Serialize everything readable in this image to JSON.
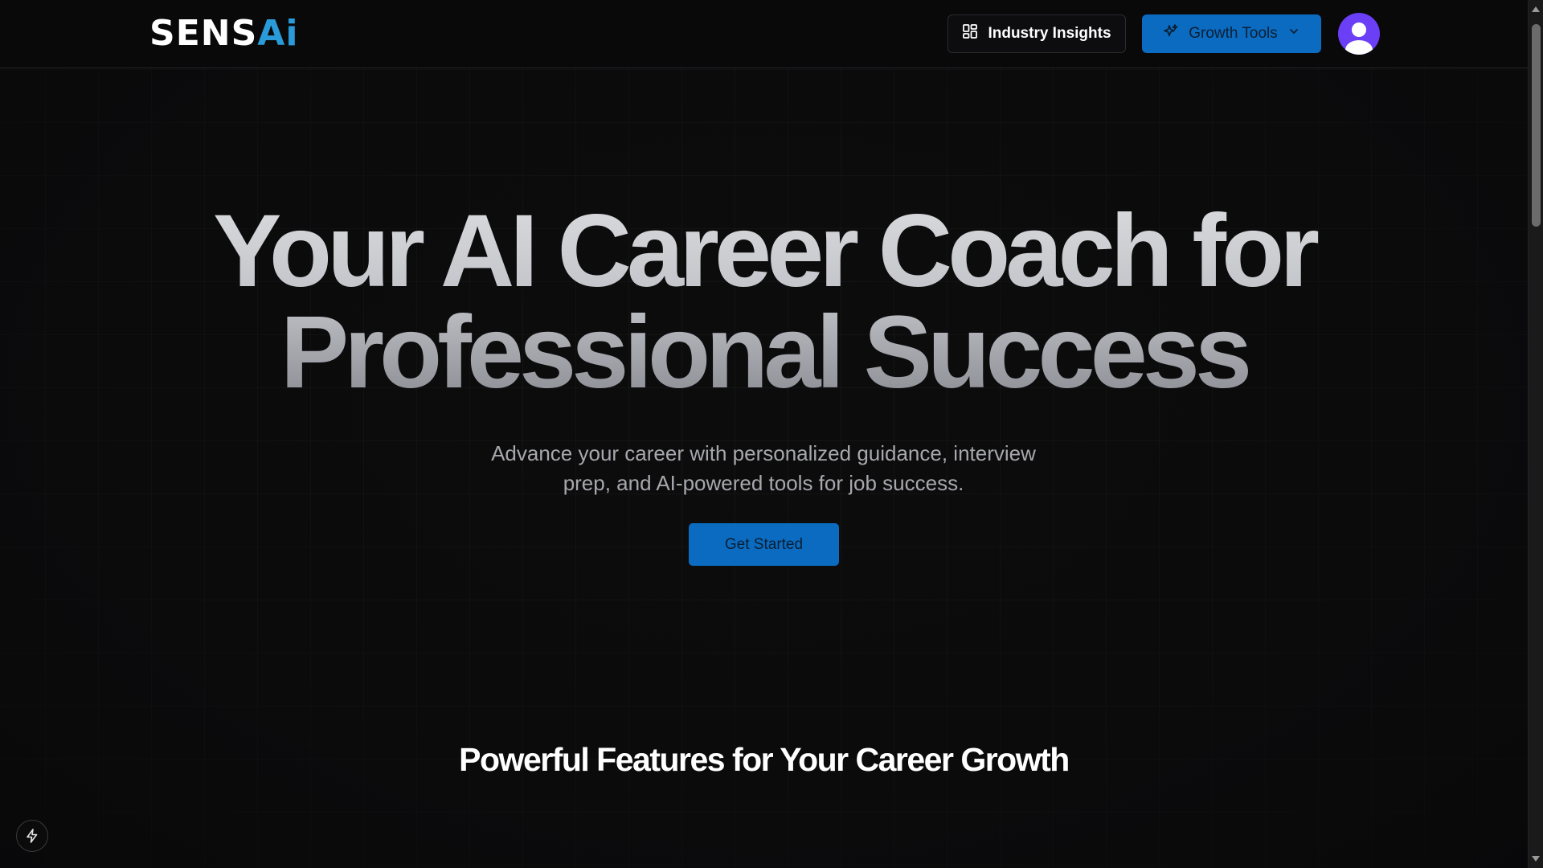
{
  "header": {
    "logo": {
      "part1": "SENS",
      "part2": "Ai"
    },
    "industry_insights_label": "Industry Insights",
    "growth_tools_label": "Growth Tools",
    "icons": {
      "insights": "layout-dashboard-icon",
      "growth": "sparkles-icon",
      "chevron": "chevron-down-icon",
      "avatar": "user-avatar-icon"
    }
  },
  "hero": {
    "title_line1": "Your AI Career Coach for",
    "title_line2": "Professional Success",
    "subtitle_line1": "Advance your career with personalized guidance, interview",
    "subtitle_line2": "prep, and AI-powered tools for job success.",
    "cta_label": "Get Started"
  },
  "features": {
    "title": "Powerful Features for Your Career Growth"
  },
  "fab": {
    "icon": "lightning-icon"
  },
  "colors": {
    "accent": "#0a6bc0",
    "logo_blue": "#2a9bd8",
    "background": "#0c0c0d",
    "avatar": "#6a3ff5"
  }
}
